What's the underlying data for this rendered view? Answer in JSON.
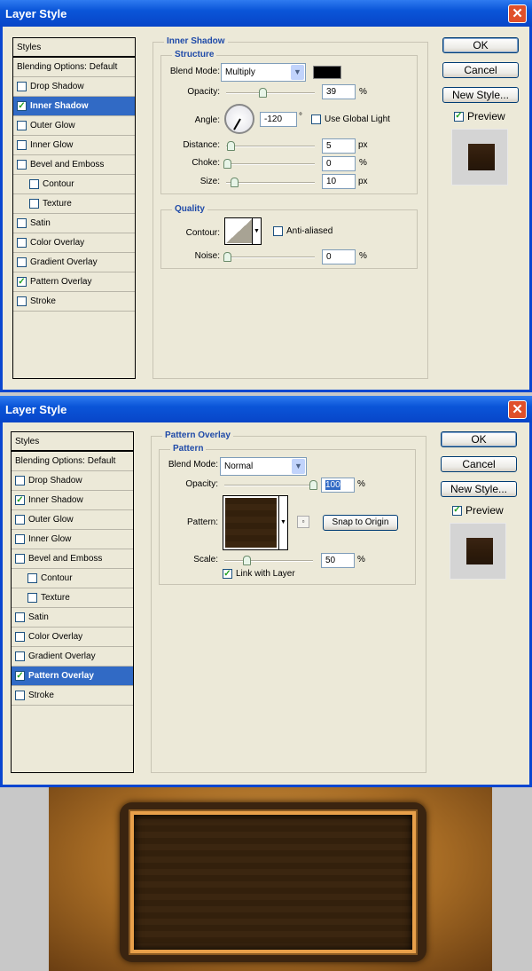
{
  "dialogs": [
    {
      "title": "Layer Style",
      "styles_header": "Styles",
      "blending": "Blending Options: Default",
      "items": [
        {
          "label": "Drop Shadow",
          "checked": false
        },
        {
          "label": "Inner Shadow",
          "checked": true,
          "selected": true
        },
        {
          "label": "Outer Glow",
          "checked": false
        },
        {
          "label": "Inner Glow",
          "checked": false
        },
        {
          "label": "Bevel and Emboss",
          "checked": false
        },
        {
          "label": "Contour",
          "checked": false,
          "indent": true
        },
        {
          "label": "Texture",
          "checked": false,
          "indent": true
        },
        {
          "label": "Satin",
          "checked": false
        },
        {
          "label": "Color Overlay",
          "checked": false
        },
        {
          "label": "Gradient Overlay",
          "checked": false
        },
        {
          "label": "Pattern Overlay",
          "checked": true
        },
        {
          "label": "Stroke",
          "checked": false
        }
      ],
      "section": "Inner Shadow",
      "group1": "Structure",
      "blend_mode_label": "Blend Mode:",
      "blend_mode": "Multiply",
      "shadow_color": "#000000",
      "opacity_label": "Opacity:",
      "opacity": "39",
      "pct": "%",
      "angle_label": "Angle:",
      "angle": "-120",
      "deg": "°",
      "global_light": "Use Global Light",
      "distance_label": "Distance:",
      "distance": "5",
      "px": "px",
      "choke_label": "Choke:",
      "choke": "0",
      "size_label": "Size:",
      "size": "10",
      "group2": "Quality",
      "contour_label": "Contour:",
      "anti_aliased": "Anti-aliased",
      "noise_label": "Noise:",
      "noise": "0",
      "ok": "OK",
      "cancel": "Cancel",
      "new_style": "New Style...",
      "preview": "Preview"
    },
    {
      "title": "Layer Style",
      "styles_header": "Styles",
      "blending": "Blending Options: Default",
      "items": [
        {
          "label": "Drop Shadow",
          "checked": false
        },
        {
          "label": "Inner Shadow",
          "checked": true
        },
        {
          "label": "Outer Glow",
          "checked": false
        },
        {
          "label": "Inner Glow",
          "checked": false
        },
        {
          "label": "Bevel and Emboss",
          "checked": false
        },
        {
          "label": "Contour",
          "checked": false,
          "indent": true
        },
        {
          "label": "Texture",
          "checked": false,
          "indent": true
        },
        {
          "label": "Satin",
          "checked": false
        },
        {
          "label": "Color Overlay",
          "checked": false
        },
        {
          "label": "Gradient Overlay",
          "checked": false
        },
        {
          "label": "Pattern Overlay",
          "checked": true,
          "selected": true
        },
        {
          "label": "Stroke",
          "checked": false
        }
      ],
      "section": "Pattern Overlay",
      "group1": "Pattern",
      "blend_mode_label": "Blend Mode:",
      "blend_mode": "Normal",
      "opacity_label": "Opacity:",
      "opacity": "100",
      "pct": "%",
      "pattern_label": "Pattern:",
      "snap": "Snap to Origin",
      "scale_label": "Scale:",
      "scale": "50",
      "link": "Link with Layer",
      "ok": "OK",
      "cancel": "Cancel",
      "new_style": "New Style...",
      "preview": "Preview"
    }
  ]
}
